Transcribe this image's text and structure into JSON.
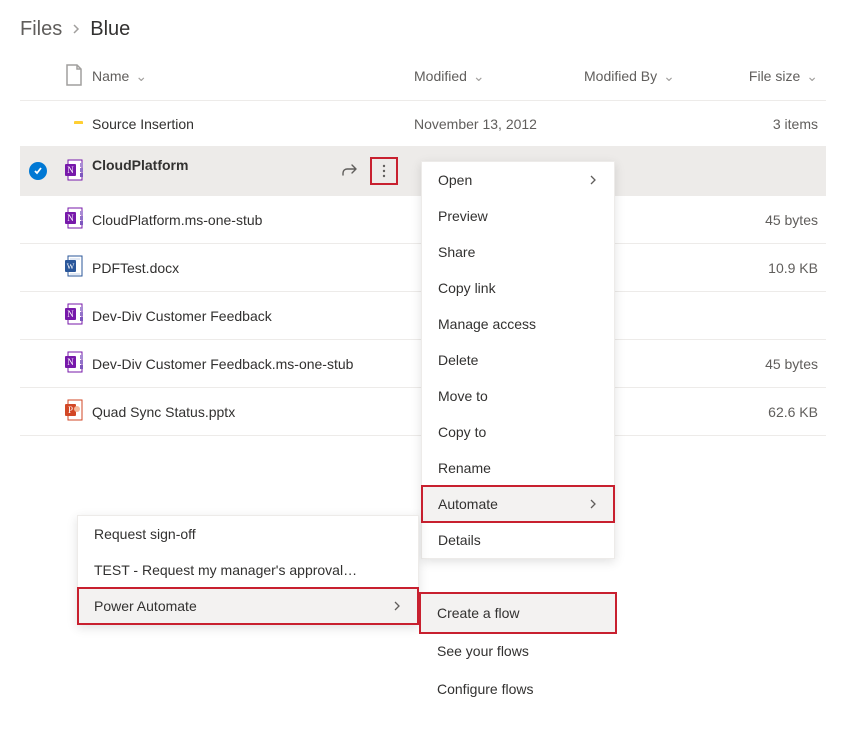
{
  "breadcrumb": {
    "root": "Files",
    "current": "Blue"
  },
  "columns": {
    "name": "Name",
    "modified": "Modified",
    "modifiedBy": "Modified By",
    "size": "File size"
  },
  "rows": [
    {
      "icon": "folder",
      "name": "Source Insertion",
      "modified": "November 13, 2012",
      "modifiedBy": "",
      "size": "3 items",
      "selected": false
    },
    {
      "icon": "onenote",
      "name": "CloudPlatform",
      "modified": "",
      "modifiedBy": "",
      "size": "",
      "selected": true
    },
    {
      "icon": "onenote",
      "name": "CloudPlatform.ms-one-stub",
      "modified": "",
      "modifiedBy": "",
      "size": "45 bytes",
      "selected": false
    },
    {
      "icon": "word",
      "name": "PDFTest.docx",
      "modified": "",
      "modifiedBy": "",
      "size": "10.9 KB",
      "selected": false
    },
    {
      "icon": "onenote",
      "name": "Dev-Div Customer Feedback",
      "modified": "",
      "modifiedBy": "",
      "size": "",
      "selected": false
    },
    {
      "icon": "onenote",
      "name": "Dev-Div Customer Feedback.ms-one-stub",
      "modified": "",
      "modifiedBy": "",
      "size": "45 bytes",
      "selected": false
    },
    {
      "icon": "ppt",
      "name": "Quad Sync Status.pptx",
      "modified": "",
      "modifiedBy": "",
      "size": "62.6 KB",
      "selected": false
    }
  ],
  "contextMenu": {
    "open": "Open",
    "preview": "Preview",
    "share": "Share",
    "copyLink": "Copy link",
    "manageAccess": "Manage access",
    "delete": "Delete",
    "moveTo": "Move to",
    "copyTo": "Copy to",
    "rename": "Rename",
    "automate": "Automate",
    "details": "Details"
  },
  "automateSubmenu": {
    "requestSignoff": "Request sign-off",
    "testRequest": "TEST - Request my manager's approval…",
    "powerAutomate": "Power Automate"
  },
  "powerAutomateSubmenu": {
    "create": "Create a flow",
    "see": "See your flows",
    "configure": "Configure flows"
  }
}
